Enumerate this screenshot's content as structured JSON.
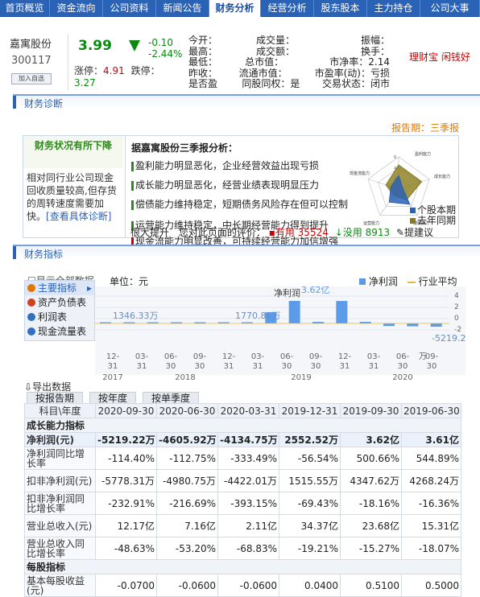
{
  "nav": {
    "tabs": [
      "首页概览",
      "资金流向",
      "公司资料",
      "新闻公告",
      "财务分析",
      "经营分析",
      "股东股本",
      "主力持仓",
      "公司大事"
    ],
    "active_index": 4
  },
  "quote": {
    "name": "嘉寓股份",
    "code": "300117",
    "add_label": "加入自选",
    "price": "3.99",
    "change": "-0.10",
    "change_pct": "-2.44%",
    "limit_up_label": "涨停：",
    "limit_up": "4.91",
    "limit_down_label": "跌停：",
    "limit_down": "3.27",
    "stats": [
      [
        "今开：",
        "成交量：",
        "振幅："
      ],
      [
        "最高：",
        "成交额：",
        "换手："
      ],
      [
        "最低：",
        "总市值：",
        "市净率：2.14"
      ],
      [
        "昨收：",
        "流通市值：",
        "市盈率(动)：亏损"
      ],
      [
        "是否盈",
        "同股同权：是",
        "交易状态：闭市"
      ]
    ],
    "right_text": "理财宝 闲钱好",
    "colors": {
      "down": "#0a8a10",
      "up": "#c00000"
    }
  },
  "diagnosis": {
    "section_title": "财务诊断",
    "report_date": "报告期：三季报",
    "status_title": "财务状况有所下降",
    "status_text": "相对同行业公司现金回收质量较高,但存货的周转速度需要加快。",
    "status_link": "[查看具体诊断]",
    "analysis_title": "据嘉寓股份三季报分析：",
    "items": [
      "盈利能力明显恶化，企业经营效益出现亏损",
      "成长能力明显恶化，经营业绩表现明显压力",
      "偿债能力维持稳定，短期债务风险存在但可以控制",
      "运营能力维持稳定，中长期经营能力得到提升",
      "现金流能力明显改善，可持续经营能力加信增强"
    ],
    "survey_prefix": "很大提升",
    "survey_question": "您对此页面的评价：",
    "survey_useful_label": "有用",
    "survey_useful_count": "35524",
    "survey_useless_label": "没用",
    "survey_useless_count": "8913",
    "survey_suggest": "提建议",
    "radar_labels": [
      "盈利能力",
      "成长能力",
      "偿债能力",
      "运营能力",
      "现金流能力"
    ],
    "radar_ticks": [
      "6",
      "4",
      "2",
      "0"
    ],
    "radar_legend": [
      "个股本期",
      "去年同期"
    ],
    "radar_colors": {
      "current": "#2a62b5",
      "last_year": "#8a7a1a"
    }
  },
  "indicators": {
    "section_title": "财务指标",
    "show_all": "显示全部数据",
    "unit_label": "单位：元",
    "menu": [
      "主要指标",
      "资产负债表",
      "利润表",
      "现金流量表"
    ],
    "export_label": "导出数据",
    "period_tabs": [
      "按报告期",
      "按年度",
      "按单季度"
    ]
  },
  "chart_data": {
    "type": "bar",
    "title": "净利润",
    "legend": [
      "净利润",
      "行业平均"
    ],
    "colors": {
      "series": "#5b9bea",
      "industry": "#e8b840"
    },
    "x_labels": [
      [
        "12-",
        "31"
      ],
      [
        "03-",
        "31"
      ],
      [
        "06-",
        "30"
      ],
      [
        "09-",
        "30"
      ],
      [
        "12-",
        "31"
      ],
      [
        "03-",
        "31"
      ],
      [
        "06-",
        "30"
      ],
      [
        "09-",
        "30"
      ],
      [
        "12-",
        "31"
      ],
      [
        "03-",
        "31"
      ],
      [
        "06-",
        "30"
      ],
      [
        "09-",
        "30"
      ]
    ],
    "year_labels": [
      "2017",
      "2018",
      "2019",
      "2020"
    ],
    "y_ticks": [
      "4",
      "2",
      "0",
      "-2"
    ],
    "annotations": [
      "1346.33万",
      "1770.86万",
      "3.62亿",
      "-5219.22万"
    ],
    "values": [
      1100,
      900,
      1346.33,
      1200,
      1300,
      1600,
      1770.86,
      18000,
      36200,
      2552.52,
      36100,
      2552.52,
      -4134.75,
      -4605.92,
      -5219.22
    ],
    "ylim": [
      -20000,
      40000
    ]
  },
  "table": {
    "headers": [
      "科目\\年度",
      "2020-09-30",
      "2020-06-30",
      "2020-03-31",
      "2019-12-31",
      "2019-09-30",
      "2019-06-30"
    ],
    "group_growth": "成长能力指标",
    "group_per_share": "每股指标",
    "rows": [
      {
        "label": "净利润(元)",
        "values": [
          "-5219.22万",
          "-4605.92万",
          "-4134.75万",
          "2552.52万",
          "3.62亿",
          "3.61亿"
        ],
        "highlight": true
      },
      {
        "label": "净利润同比增长率",
        "values": [
          "-114.40%",
          "-112.75%",
          "-333.49%",
          "-56.54%",
          "500.66%",
          "544.89%"
        ]
      },
      {
        "label": "扣非净利润(元)",
        "values": [
          "-5778.31万",
          "-4980.75万",
          "-4422.01万",
          "1515.55万",
          "4347.62万",
          "4268.24万"
        ]
      },
      {
        "label": "扣非净利润同比增长率",
        "values": [
          "-232.91%",
          "-216.69%",
          "-393.15%",
          "-69.43%",
          "-18.16%",
          "-16.36%"
        ]
      },
      {
        "label": "营业总收入(元)",
        "values": [
          "12.17亿",
          "7.16亿",
          "2.11亿",
          "34.37亿",
          "23.68亿",
          "15.31亿"
        ]
      },
      {
        "label": "营业总收入同比增长率",
        "values": [
          "-48.63%",
          "-53.20%",
          "-68.83%",
          "-19.21%",
          "-15.27%",
          "-18.07%"
        ]
      }
    ],
    "per_share_rows": [
      {
        "label": "基本每股收益(元)",
        "values": [
          "-0.0700",
          "-0.0600",
          "-0.0600",
          "0.0400",
          "0.5100",
          "0.5000"
        ]
      }
    ]
  }
}
